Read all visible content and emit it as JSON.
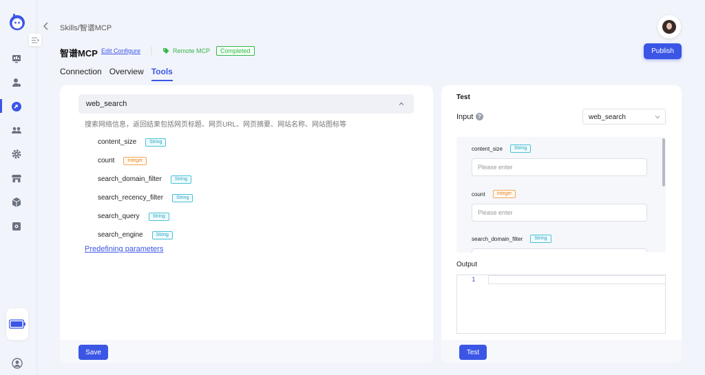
{
  "header": {
    "breadcrumb": "Skills/智谱MCP",
    "title": "智谱MCP",
    "edit_link": "Edit Configure",
    "mcp_type": "Remote MCP",
    "status": "Completed",
    "publish_label": "Publish"
  },
  "tabs": [
    {
      "label": "Connection"
    },
    {
      "label": "Overview"
    },
    {
      "label": "Tools"
    }
  ],
  "tool": {
    "name": "web_search",
    "description": "搜索网络信息，返回结果包括网页标题、网页URL、网页摘要、网站名称、网站图标等",
    "params": [
      {
        "name": "content_size",
        "type": "String"
      },
      {
        "name": "count",
        "type": "Integer"
      },
      {
        "name": "search_domain_filter",
        "type": "String"
      },
      {
        "name": "search_recency_filter",
        "type": "String"
      },
      {
        "name": "search_query",
        "type": "String"
      },
      {
        "name": "search_engine",
        "type": "String"
      }
    ],
    "predefine_link": "Predefining parameters",
    "save_label": "Save"
  },
  "test": {
    "title": "Test",
    "input_label": "Input",
    "help_glyph": "?",
    "selected_tool": "web_search",
    "fields": [
      {
        "name": "content_size",
        "type": "String",
        "placeholder": "Please enter"
      },
      {
        "name": "count",
        "type": "Integer",
        "placeholder": "Please enter"
      },
      {
        "name": "search_domain_filter",
        "type": "String",
        "placeholder": ""
      }
    ],
    "output_label": "Output",
    "line_number": "1",
    "test_label": "Test"
  },
  "colors": {
    "accent": "#3b56e5",
    "success": "#35b54a",
    "string_tag": "#22a4c0",
    "integer_tag": "#e5882c"
  },
  "icons": [
    "logo-icon",
    "collapse-icon",
    "monitor-icon",
    "user-settings-icon",
    "skills-icon",
    "team-icon",
    "gear-icon",
    "store-icon",
    "package-icon",
    "plugin-icon",
    "battery-icon",
    "user-circle-icon",
    "back-icon",
    "tag-icon",
    "chevron-up-icon",
    "chevron-down-icon",
    "help-icon"
  ]
}
